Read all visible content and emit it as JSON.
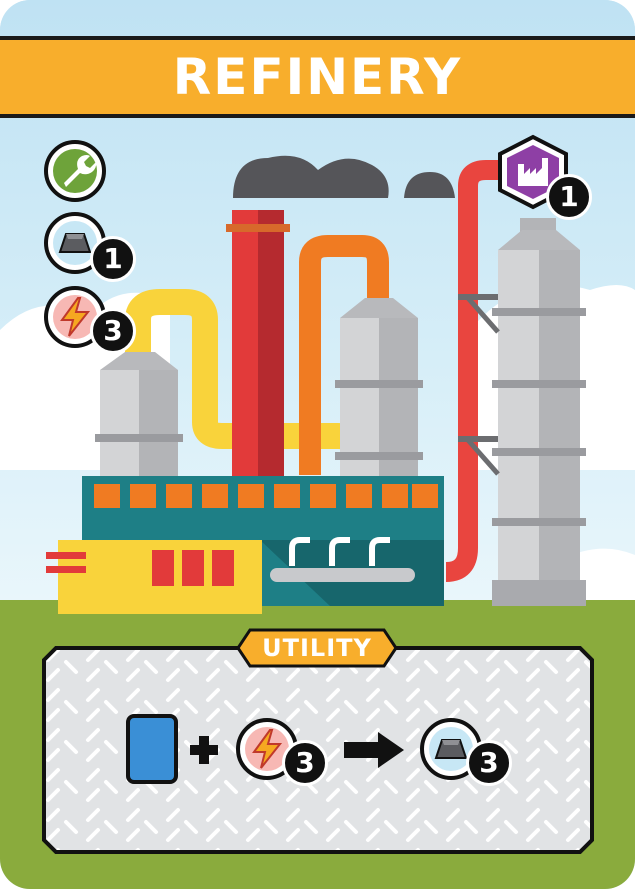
{
  "card": {
    "title": "REFINERY",
    "colors": {
      "banner": "#f8ae2c",
      "sky": "#cfe9f5",
      "ground": "#8aab3d",
      "factory_teal": "#1e7f86",
      "chimney_red": "#e23a3a",
      "pipe_yellow": "#f9d33b",
      "pipe_orange": "#f07b22",
      "pipe_red": "#e9453f",
      "tank_gray": "#c8c9cc"
    },
    "side_icons": [
      {
        "icon": "wrench-icon",
        "value": ""
      },
      {
        "icon": "metal-ingot-icon",
        "value": "1"
      },
      {
        "icon": "energy-bolt-icon",
        "value": "3"
      }
    ],
    "corner_icon": {
      "icon": "factory-hexagon-icon",
      "value": "1"
    },
    "utility": {
      "label": "UTILITY",
      "ability": {
        "card_icon": "blue-card-icon",
        "plus": "+",
        "energy_icon": "energy-bolt-icon",
        "energy_value": "3",
        "arrow": "arrow-right-icon",
        "output_icon": "metal-ingot-icon",
        "output_value": "3"
      }
    }
  }
}
